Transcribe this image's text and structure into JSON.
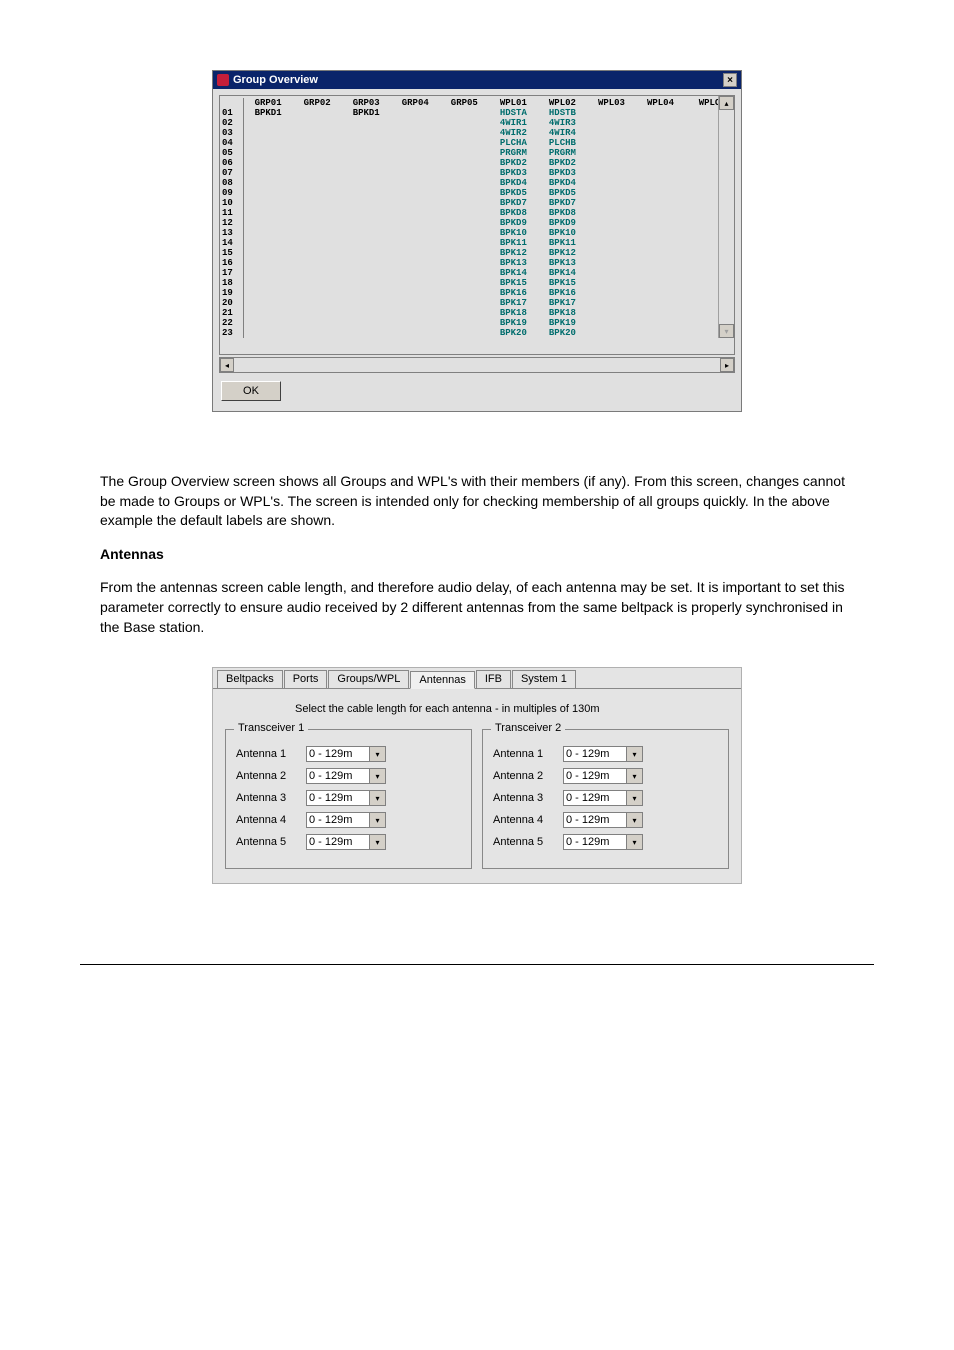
{
  "group_overview": {
    "title": "Group Overview",
    "close_glyph": "×",
    "columns": [
      "GRP01",
      "GRP02",
      "GRP03",
      "GRP04",
      "GRP05",
      "WPL01",
      "WPL02",
      "WPL03",
      "WPL04",
      "WPLC"
    ],
    "rows": [
      {
        "n": "01",
        "c": [
          "BPKD1",
          "",
          "BPKD1",
          "",
          "",
          "HDSTA",
          "HDSTB",
          "",
          "",
          ""
        ]
      },
      {
        "n": "02",
        "c": [
          "",
          "",
          "",
          "",
          "",
          "4WIR1",
          "4WIR3",
          "",
          "",
          ""
        ]
      },
      {
        "n": "03",
        "c": [
          "",
          "",
          "",
          "",
          "",
          "4WIR2",
          "4WIR4",
          "",
          "",
          ""
        ]
      },
      {
        "n": "04",
        "c": [
          "",
          "",
          "",
          "",
          "",
          "PLCHA",
          "PLCHB",
          "",
          "",
          ""
        ]
      },
      {
        "n": "05",
        "c": [
          "",
          "",
          "",
          "",
          "",
          "PRGRM",
          "PRGRM",
          "",
          "",
          ""
        ]
      },
      {
        "n": "06",
        "c": [
          "",
          "",
          "",
          "",
          "",
          "BPKD2",
          "BPKD2",
          "",
          "",
          ""
        ]
      },
      {
        "n": "07",
        "c": [
          "",
          "",
          "",
          "",
          "",
          "BPKD3",
          "BPKD3",
          "",
          "",
          ""
        ]
      },
      {
        "n": "08",
        "c": [
          "",
          "",
          "",
          "",
          "",
          "BPKD4",
          "BPKD4",
          "",
          "",
          ""
        ]
      },
      {
        "n": "09",
        "c": [
          "",
          "",
          "",
          "",
          "",
          "BPKD5",
          "BPKD5",
          "",
          "",
          ""
        ]
      },
      {
        "n": "10",
        "c": [
          "",
          "",
          "",
          "",
          "",
          "BPKD7",
          "BPKD7",
          "",
          "",
          ""
        ]
      },
      {
        "n": "11",
        "c": [
          "",
          "",
          "",
          "",
          "",
          "BPKD8",
          "BPKD8",
          "",
          "",
          ""
        ]
      },
      {
        "n": "12",
        "c": [
          "",
          "",
          "",
          "",
          "",
          "BPKD9",
          "BPKD9",
          "",
          "",
          ""
        ]
      },
      {
        "n": "13",
        "c": [
          "",
          "",
          "",
          "",
          "",
          "BPK10",
          "BPK10",
          "",
          "",
          ""
        ]
      },
      {
        "n": "14",
        "c": [
          "",
          "",
          "",
          "",
          "",
          "BPK11",
          "BPK11",
          "",
          "",
          ""
        ]
      },
      {
        "n": "15",
        "c": [
          "",
          "",
          "",
          "",
          "",
          "BPK12",
          "BPK12",
          "",
          "",
          ""
        ]
      },
      {
        "n": "16",
        "c": [
          "",
          "",
          "",
          "",
          "",
          "BPK13",
          "BPK13",
          "",
          "",
          ""
        ]
      },
      {
        "n": "17",
        "c": [
          "",
          "",
          "",
          "",
          "",
          "BPK14",
          "BPK14",
          "",
          "",
          ""
        ]
      },
      {
        "n": "18",
        "c": [
          "",
          "",
          "",
          "",
          "",
          "BPK15",
          "BPK15",
          "",
          "",
          ""
        ]
      },
      {
        "n": "19",
        "c": [
          "",
          "",
          "",
          "",
          "",
          "BPK16",
          "BPK16",
          "",
          "",
          ""
        ]
      },
      {
        "n": "20",
        "c": [
          "",
          "",
          "",
          "",
          "",
          "BPK17",
          "BPK17",
          "",
          "",
          ""
        ]
      },
      {
        "n": "21",
        "c": [
          "",
          "",
          "",
          "",
          "",
          "BPK18",
          "BPK18",
          "",
          "",
          ""
        ]
      },
      {
        "n": "22",
        "c": [
          "",
          "",
          "",
          "",
          "",
          "BPK19",
          "BPK19",
          "",
          "",
          ""
        ]
      },
      {
        "n": "23",
        "c": [
          "",
          "",
          "",
          "",
          "",
          "BPK20",
          "BPK20",
          "",
          "",
          ""
        ]
      }
    ],
    "ok_label": "OK",
    "arrows": {
      "up": "▴",
      "down": "▾",
      "left": "◂",
      "right": "▸"
    }
  },
  "bodytext": {
    "p1": "The Group Overview screen shows all Groups and WPL's with their members (if any). From this screen, changes cannot be made to Groups or WPL's. The screen is intended only for checking membership of all groups quickly. In the above example the default labels are shown.",
    "heading": "Antennas",
    "p2": "From the antennas screen cable length, and therefore audio delay, of each antenna may be set. It is important to set this parameter correctly to ensure audio received by 2 different antennas from the same beltpack is properly synchronised in the Base station."
  },
  "antennas_panel": {
    "tabs": [
      "Beltpacks",
      "Ports",
      "Groups/WPL",
      "Antennas",
      "IFB",
      "System 1"
    ],
    "active_tab": 3,
    "instruction": "Select the cable length for each antenna - in multiples of 130m",
    "transceivers": [
      {
        "title": "Transceiver 1",
        "ants": [
          {
            "label": "Antenna 1",
            "val": "0 - 129m"
          },
          {
            "label": "Antenna 2",
            "val": "0 - 129m"
          },
          {
            "label": "Antenna 3",
            "val": "0 - 129m"
          },
          {
            "label": "Antenna 4",
            "val": "0 - 129m"
          },
          {
            "label": "Antenna 5",
            "val": "0 - 129m"
          }
        ]
      },
      {
        "title": "Transceiver 2",
        "ants": [
          {
            "label": "Antenna 1",
            "val": "0 - 129m"
          },
          {
            "label": "Antenna 2",
            "val": "0 - 129m"
          },
          {
            "label": "Antenna 3",
            "val": "0 - 129m"
          },
          {
            "label": "Antenna 4",
            "val": "0 - 129m"
          },
          {
            "label": "Antenna 5",
            "val": "0 - 129m"
          }
        ]
      }
    ],
    "drop_glyph": "▾"
  }
}
